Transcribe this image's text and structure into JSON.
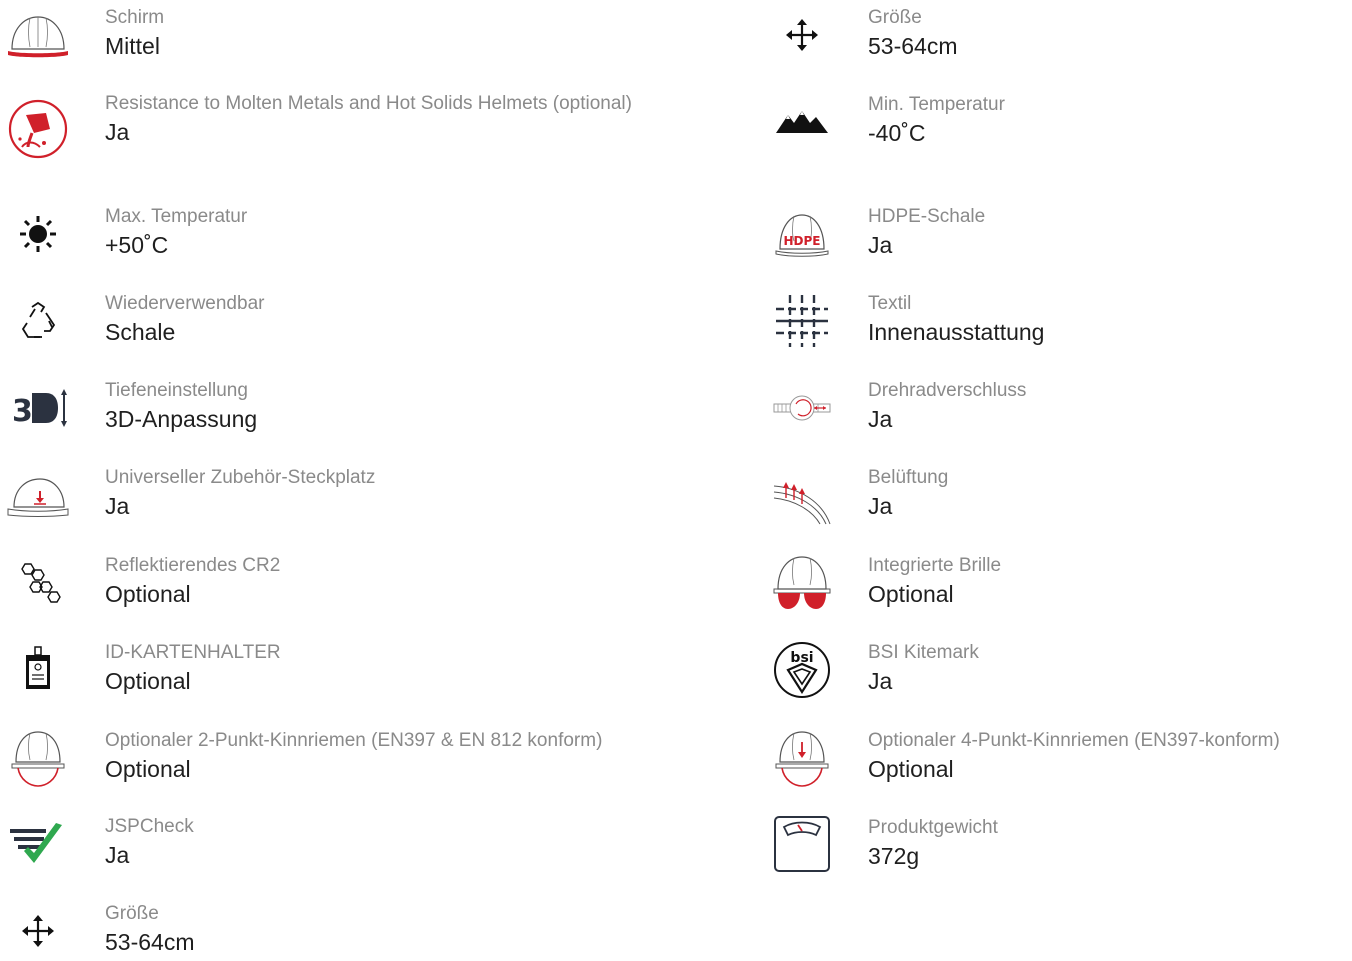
{
  "colors": {
    "label": "#8a8a8a",
    "value": "#1f1f1f",
    "accent_red": "#d0202a",
    "check_green": "#2fa84f",
    "dark_icon": "#2b3240"
  },
  "left_column": [
    {
      "icon": "helmet-brim-icon",
      "label": "Schirm",
      "value": "Mittel"
    },
    {
      "icon": "molten-metal-icon",
      "label": "Resistance to Molten Metals and Hot Solids Helmets (optional)",
      "value": "Ja"
    },
    {
      "icon": "sun-icon",
      "label": "Max. Temperatur",
      "value": "+50˚C"
    },
    {
      "icon": "recycle-icon",
      "label": "Wiederverwendbar",
      "value": "Schale"
    },
    {
      "icon": "3d-adjust-icon",
      "label": "Tiefeneinstellung",
      "value": "3D-Anpassung"
    },
    {
      "icon": "accessory-slot-icon",
      "label": "Universeller Zubehör-Steckplatz",
      "value": "Ja"
    },
    {
      "icon": "reflective-hexagon-icon",
      "label": "Reflektierendes CR2",
      "value": "Optional"
    },
    {
      "icon": "id-card-holder-icon",
      "label": "ID-KARTENHALTER",
      "value": "Optional"
    },
    {
      "icon": "helmet-chinstrap-2pt-icon",
      "label": "Optionaler 2-Punkt-Kinnriemen (EN397 & EN 812 konform)",
      "value": "Optional"
    },
    {
      "icon": "jspcheck-icon",
      "label": "JSPCheck",
      "value": "Ja"
    },
    {
      "icon": "size-arrows-icon",
      "label": "Größe",
      "value": "53-64cm"
    }
  ],
  "right_column": [
    {
      "icon": "size-arrows-icon",
      "label": "Größe",
      "value": "53-64cm"
    },
    {
      "icon": "mountains-icon",
      "label": "Min. Temperatur",
      "value": "-40˚C"
    },
    {
      "icon": "hdpe-helmet-icon",
      "label": "HDPE-Schale",
      "value": "Ja",
      "icon_text": "HDPE"
    },
    {
      "icon": "textile-icon",
      "label": "Textil",
      "value": "Innenausstattung"
    },
    {
      "icon": "wheel-ratchet-icon",
      "label": "Drehradverschluss",
      "value": "Ja"
    },
    {
      "icon": "ventilation-icon",
      "label": "Belüftung",
      "value": "Ja"
    },
    {
      "icon": "integrated-glasses-icon",
      "label": "Integrierte Brille",
      "value": "Optional"
    },
    {
      "icon": "bsi-kitemark-icon",
      "label": "BSI Kitemark",
      "value": "Ja",
      "icon_text": "bsi"
    },
    {
      "icon": "helmet-chinstrap-4pt-icon",
      "label": "Optionaler 4-Punkt-Kinnriemen (EN397-konform)",
      "value": "Optional"
    },
    {
      "icon": "weight-scale-icon",
      "label": "Produktgewicht",
      "value": "372g"
    }
  ]
}
